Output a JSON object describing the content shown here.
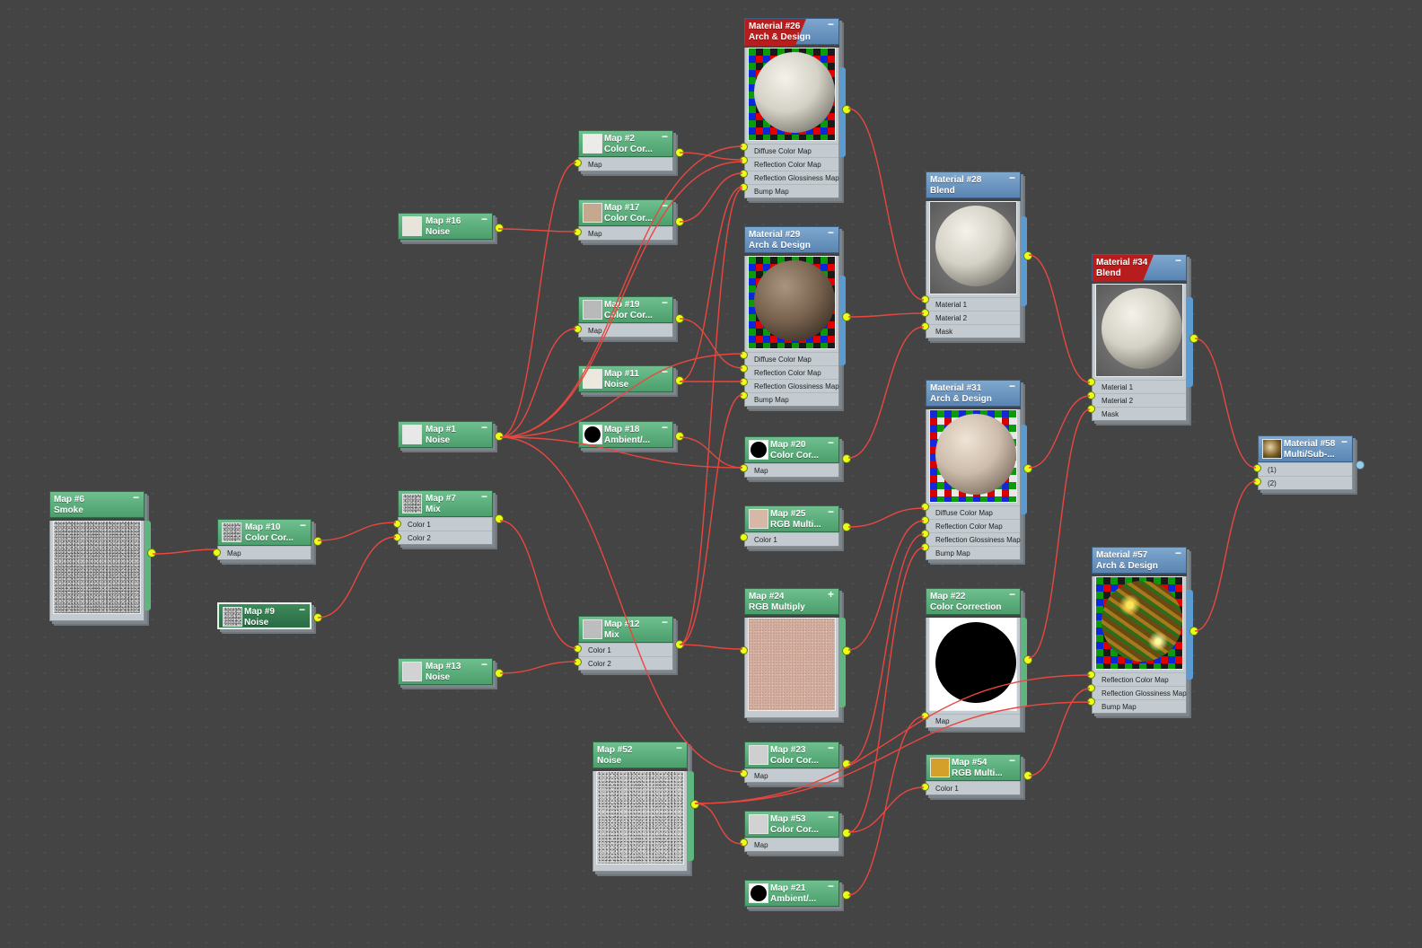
{
  "colors": {
    "map_header": "#5aae7b",
    "material_header": "#6b96c2",
    "wire": "#e8473f",
    "port": "#e8ff16",
    "flag": "#c21d1d"
  },
  "nodes": {
    "map6": {
      "title": "Map #6",
      "type": "Smoke"
    },
    "map10": {
      "title": "Map #10",
      "type": "Color Cor...",
      "slots": [
        "Map"
      ]
    },
    "map9": {
      "title": "Map #9",
      "type": "Noise"
    },
    "map16": {
      "title": "Map #16",
      "type": "Noise"
    },
    "map1": {
      "title": "Map #1",
      "type": "Noise"
    },
    "map7": {
      "title": "Map #7",
      "type": "Mix",
      "slots": [
        "Color 1",
        "Color 2"
      ]
    },
    "map13": {
      "title": "Map #13",
      "type": "Noise"
    },
    "map2": {
      "title": "Map #2",
      "type": "Color Cor...",
      "slots": [
        "Map"
      ]
    },
    "map17": {
      "title": "Map #17",
      "type": "Color Cor...",
      "slots": [
        "Map"
      ]
    },
    "map19": {
      "title": "Map #19",
      "type": "Color Cor...",
      "slots": [
        "Map"
      ]
    },
    "map11": {
      "title": "Map #11",
      "type": "Noise"
    },
    "map18": {
      "title": "Map #18",
      "type": "Ambient/..."
    },
    "map12": {
      "title": "Map #12",
      "type": "Mix",
      "slots": [
        "Color 1",
        "Color 2"
      ]
    },
    "map52": {
      "title": "Map #52",
      "type": "Noise"
    },
    "mat26": {
      "title": "Material #26",
      "type": "Arch & Design",
      "slots": [
        "Diffuse Color Map",
        "Reflection Color Map",
        "Reflection Glossiness Map",
        "Bump Map"
      ]
    },
    "mat29": {
      "title": "Material #29",
      "type": "Arch & Design",
      "slots": [
        "Diffuse Color Map",
        "Reflection Color Map",
        "Reflection Glossiness Map",
        "Bump Map"
      ]
    },
    "map20": {
      "title": "Map #20",
      "type": "Color Cor...",
      "slots": [
        "Map"
      ]
    },
    "map25": {
      "title": "Map #25",
      "type": "RGB Multi...",
      "slots": [
        "Color 1"
      ]
    },
    "map24": {
      "title": "Map #24",
      "type": "RGB Multiply"
    },
    "map23": {
      "title": "Map #23",
      "type": "Color Cor...",
      "slots": [
        "Map"
      ]
    },
    "map53": {
      "title": "Map #53",
      "type": "Color Cor...",
      "slots": [
        "Map"
      ]
    },
    "map21": {
      "title": "Map #21",
      "type": "Ambient/..."
    },
    "mat28": {
      "title": "Material #28",
      "type": "Blend",
      "slots": [
        "Material 1",
        "Material 2",
        "Mask"
      ]
    },
    "mat31": {
      "title": "Material #31",
      "type": "Arch & Design",
      "slots": [
        "Diffuse Color Map",
        "Reflection Color Map",
        "Reflection Glossiness Map",
        "Bump Map"
      ]
    },
    "map22": {
      "title": "Map #22",
      "type": "Color Correction",
      "slots": [
        "Map"
      ]
    },
    "map54": {
      "title": "Map #54",
      "type": "RGB Multi...",
      "slots": [
        "Color 1"
      ]
    },
    "mat34": {
      "title": "Material #34",
      "type": "Blend",
      "slots": [
        "Material 1",
        "Material 2",
        "Mask"
      ]
    },
    "mat57": {
      "title": "Material #57",
      "type": "Arch & Design",
      "slots": [
        "Reflection Color Map",
        "Reflection Glossiness Map",
        "Bump Map"
      ]
    },
    "mat58": {
      "title": "Material #58",
      "type": "Multi/Sub-...",
      "slots": [
        "(1)",
        "(2)"
      ]
    }
  },
  "controls": {
    "minimize": "−",
    "plus": "+"
  }
}
